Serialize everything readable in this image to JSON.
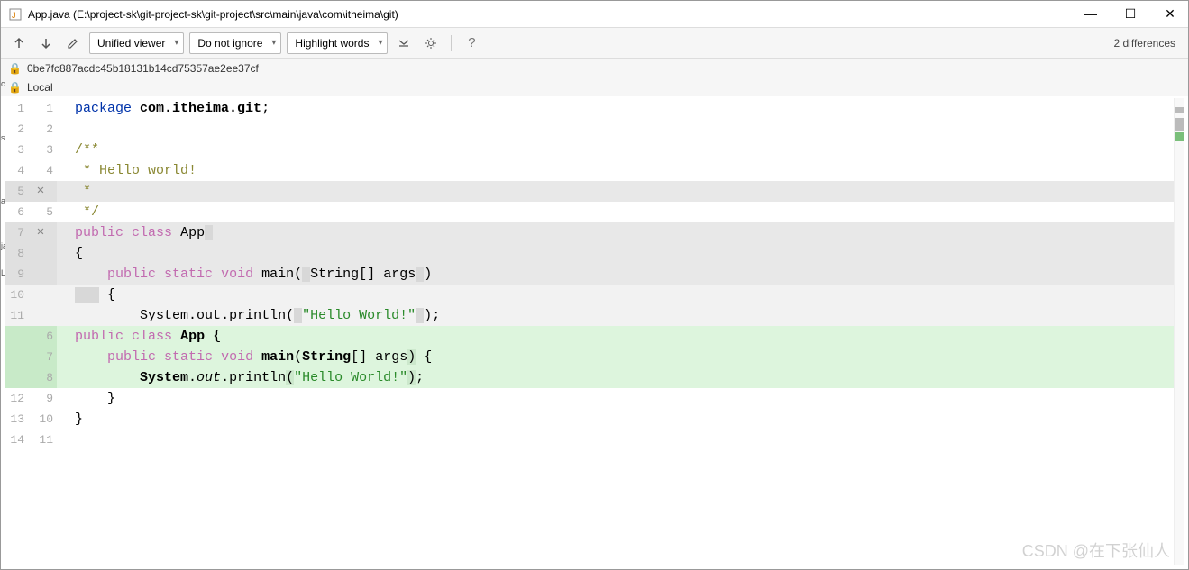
{
  "window": {
    "title": "App.java (E:\\project-sk\\git-project-sk\\git-project\\src\\main\\java\\com\\itheima\\git)"
  },
  "toolbar": {
    "viewer": "Unified viewer",
    "ignore": "Do not ignore",
    "highlight": "Highlight words",
    "diff_count": "2 differences"
  },
  "info": {
    "commit": "0be7fc887acdc45b18131b14cd75357ae2ee37cf",
    "side": "Local"
  },
  "code_tokens": {
    "package": "package",
    "pkgname": "com.itheima.git",
    "c1": "/**",
    "c2": " * Hello world!",
    "c3": " *",
    "c4": " */",
    "public": "public",
    "class": "class",
    "App1": "App",
    "App2": "App",
    "ob": "{",
    "cb": "}",
    "static": "static",
    "void": "void",
    "main": "main",
    "String": "String",
    "args": "args",
    "System": "System",
    "out": "out",
    "println": "println",
    "hw": "\"Hello World!\"",
    "bracks": "[]",
    "op": "(",
    "cp": ")",
    "sc": ";",
    "sp": " "
  },
  "lines": [
    {
      "l": "1",
      "r": "1"
    },
    {
      "l": "2",
      "r": "2"
    },
    {
      "l": "3",
      "r": "3"
    },
    {
      "l": "4",
      "r": "4"
    },
    {
      "l": "5",
      "r": ""
    },
    {
      "l": "6",
      "r": "5"
    },
    {
      "l": "7",
      "r": ""
    },
    {
      "l": "8",
      "r": ""
    },
    {
      "l": "9",
      "r": ""
    },
    {
      "l": "10",
      "r": ""
    },
    {
      "l": "11",
      "r": ""
    },
    {
      "l": "",
      "r": "6"
    },
    {
      "l": "",
      "r": "7"
    },
    {
      "l": "",
      "r": "8"
    },
    {
      "l": "12",
      "r": "9"
    },
    {
      "l": "13",
      "r": "10"
    },
    {
      "l": "14",
      "r": "11"
    }
  ],
  "left_chips": [
    "c",
    "st",
    "a",
    "ai",
    "ja",
    "L"
  ],
  "watermark": "CSDN @在下张仙人"
}
